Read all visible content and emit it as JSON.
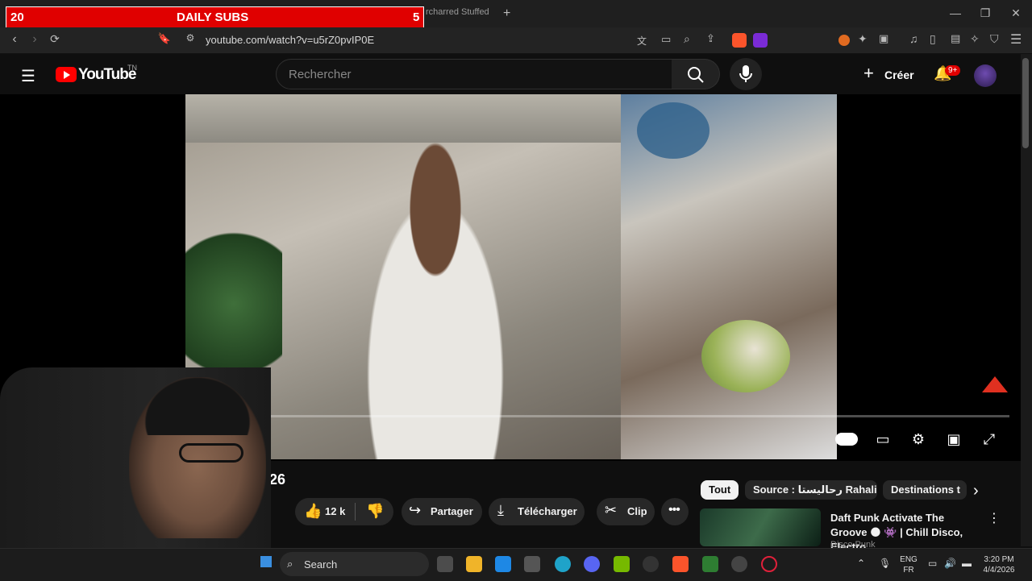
{
  "overlay": {
    "left_count": "20",
    "title": "DAILY SUBS",
    "right_count": "5"
  },
  "browser": {
    "tab_title": "rcharred Stuffed",
    "new_tab_icon": "plus-icon",
    "url": "youtube.com/watch?v=u5rZ0pvIP0E"
  },
  "youtube": {
    "logo_text": "YouTube",
    "country": "TN",
    "search_placeholder": "Rechercher",
    "create_label": "Créer",
    "notif_badge": "9+",
    "video_title_fragment": "026",
    "actions": {
      "likes": "12 k",
      "share": "Partager",
      "download": "Télécharger",
      "clip": "Clip"
    },
    "chips": [
      "Tout",
      "Source : رحاليستا Rahalista",
      "Destinations t"
    ],
    "recommendation": {
      "title": "Daft Punk Activate The Groove 🌑 👾 | Chill Disco, Electro ...",
      "channel": "Disco Punk"
    },
    "progress_fraction": 0.03
  },
  "taskbar": {
    "search_label": "Search",
    "lang_top": "ENG",
    "lang_bottom": "FR",
    "time": "3:20 PM",
    "date": "4/4/2026"
  }
}
